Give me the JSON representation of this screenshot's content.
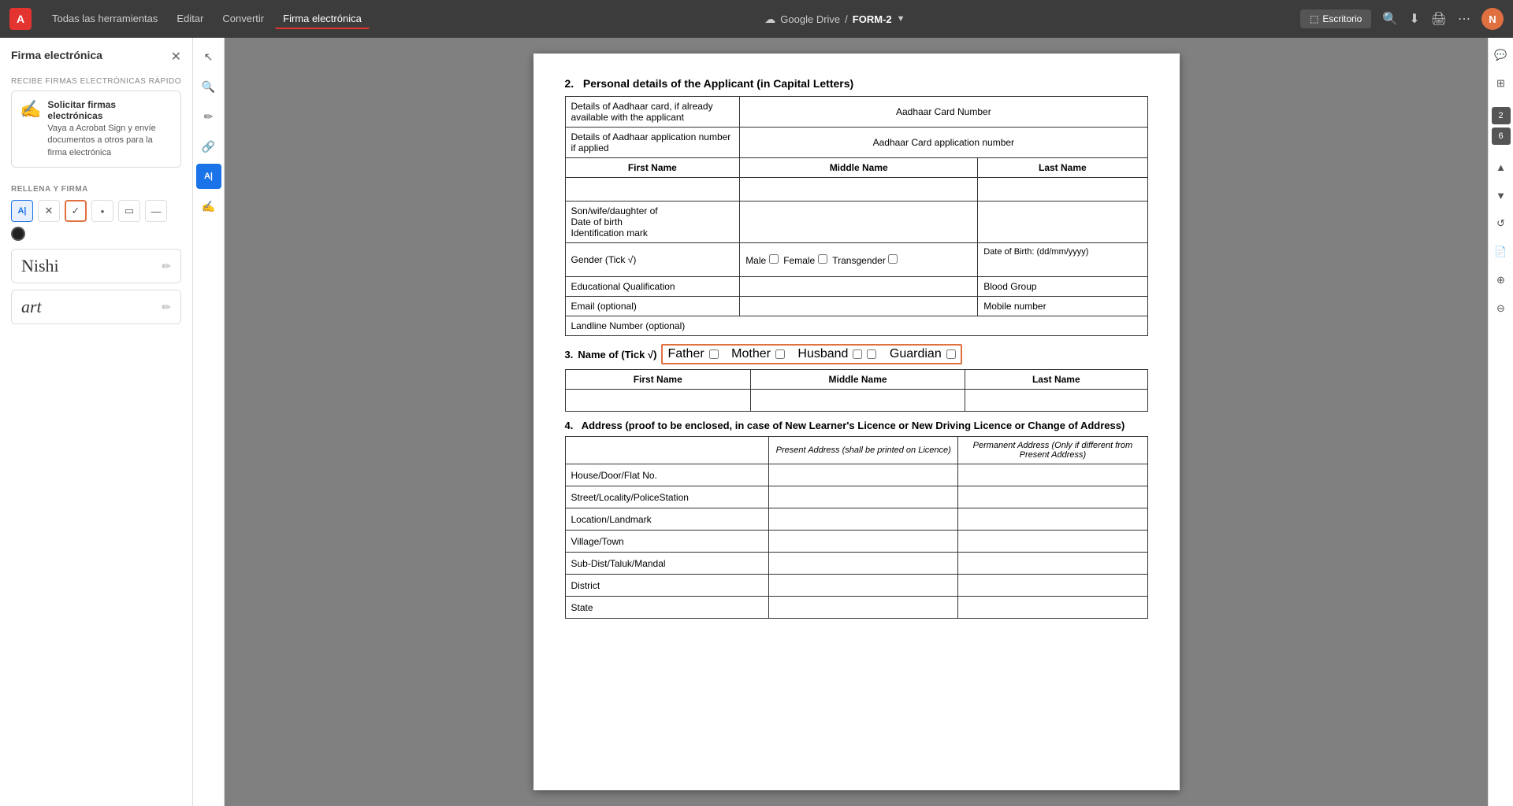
{
  "topbar": {
    "logo": "A",
    "menus": [
      "Todas las herramientas",
      "Editar",
      "Convertir",
      "Firma electrónica"
    ],
    "active_menu": "Firma electrónica",
    "cloud_label": "Google Drive",
    "separator": "/",
    "doc_name": "FORM-2",
    "desktop_btn": "Escritorio",
    "icons": [
      "search",
      "download",
      "print",
      "more"
    ]
  },
  "sidebar": {
    "title": "Firma electrónica",
    "section1_label": "RECIBE FIRMAS ELECTRÓNICAS RÁPIDO",
    "card_title": "Solicitar firmas electrónicas",
    "card_text": "Vaya a Acrobat Sign y envíe documentos a otros para la firma electrónica",
    "section2_label": "RELLENA Y FIRMA",
    "signatures": [
      {
        "text": "Nishi",
        "style": "normal"
      },
      {
        "text": "art",
        "style": "italic"
      }
    ]
  },
  "tools": {
    "tool_list": [
      "cursor",
      "zoom-in",
      "pencil",
      "link",
      "text-tool",
      "draw"
    ]
  },
  "form": {
    "section2_title": "2.",
    "section2_heading": "Personal details of the Applicant (in Capital Letters)",
    "rows": [
      {
        "label": "Details of Aadhaar card, if already available with the applicant",
        "value": "Aadhaar Card Number",
        "colspan": true
      },
      {
        "label": "Details of Aadhaar application number if applied",
        "value": "Aadhaar Card application number",
        "colspan": true
      }
    ],
    "name_headers": [
      "First Name",
      "Middle Name",
      "Last Name"
    ],
    "son_row_label": "Son/wife/daughter of\nDate of birth\nIdentification mark",
    "gender_label": "Gender (Tick √)",
    "gender_options": [
      "Male",
      "Female",
      "Transgender"
    ],
    "dob_label": "Date of Birth: (dd/mm/yyyy)",
    "edu_label": "Educational Qualification",
    "blood_label": "Blood Group",
    "email_label": "Email (optional)",
    "mobile_label": "Mobile number",
    "landline_label": "Landline Number (optional)",
    "section3_title": "3.",
    "section3_heading": "Name of (Tick √)",
    "name_of_options": [
      "Father",
      "Mother",
      "Husband",
      "Guardian"
    ],
    "name_headers2": [
      "First Name",
      "Middle Name",
      "Last Name"
    ],
    "section4_title": "4.",
    "section4_heading": "Address (proof to be enclosed, in case of New Learner's Licence or New Driving Licence or Change of Address)",
    "address_col1": "Present Address (shall be printed on Licence)",
    "address_col2": "Permanent Address (Only if different from Present Address)",
    "address_rows": [
      "House/Door/Flat No.",
      "Street/Locality/PoliceStation",
      "Location/Landmark",
      "Village/Town",
      "Sub-Dist/Taluk/Mandal",
      "District",
      "State"
    ]
  },
  "right_sidebar": {
    "page_nums": [
      "2",
      "6"
    ]
  }
}
